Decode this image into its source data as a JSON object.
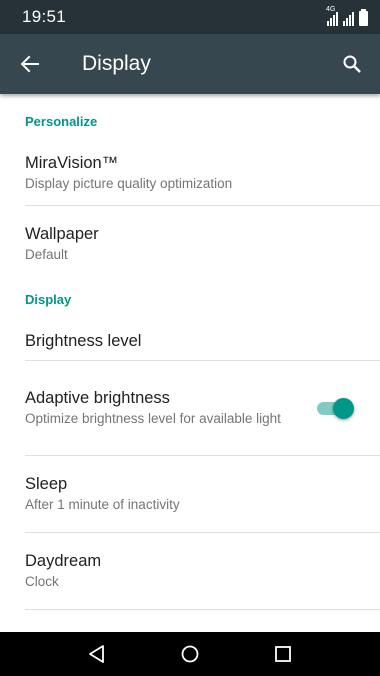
{
  "status_bar": {
    "time": "19:51",
    "network_label": "4G"
  },
  "app_bar": {
    "title": "Display",
    "back_icon": "arrow-back-icon",
    "search_icon": "search-icon",
    "background": "#37474f"
  },
  "sections": {
    "personalize": "Personalize",
    "display": "Display"
  },
  "items": {
    "miravision": {
      "title": "MiraVision™",
      "summary": "Display picture quality optimization"
    },
    "wallpaper": {
      "title": "Wallpaper",
      "summary": "Default"
    },
    "brightness": {
      "title": "Brightness level"
    },
    "adaptive": {
      "title": "Adaptive brightness",
      "summary": "Optimize brightness level for available light",
      "enabled": true
    },
    "sleep": {
      "title": "Sleep",
      "summary": "After 1 minute of inactivity"
    },
    "daydream": {
      "title": "Daydream",
      "summary": "Clock"
    }
  },
  "nav_bar": {
    "back_icon": "triangle-back-icon",
    "home_icon": "circle-home-icon",
    "recents_icon": "square-recents-icon"
  },
  "colors": {
    "accent": "#009688",
    "status_bar": "#263238"
  }
}
